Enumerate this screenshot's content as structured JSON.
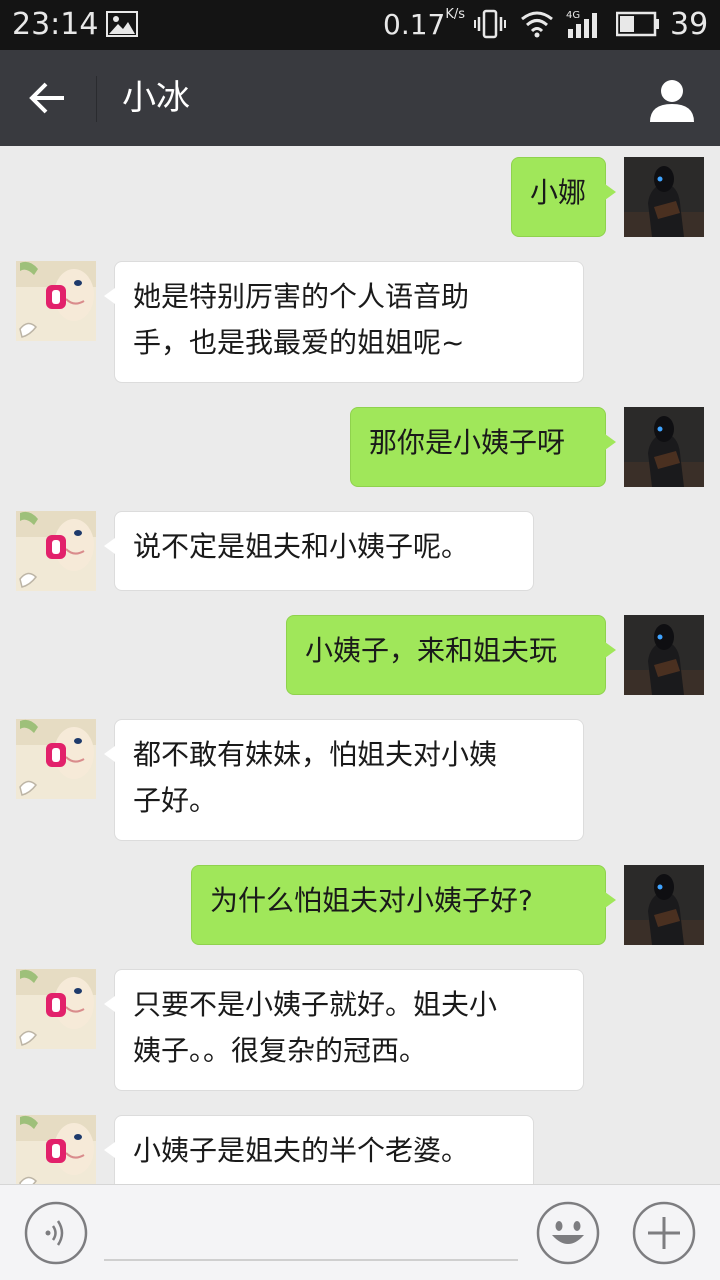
{
  "status_bar": {
    "time": "23:14",
    "net_speed": "0.17",
    "net_speed_unit": "K/s",
    "network_type": "4G",
    "battery_level": "39",
    "icons": [
      "image-icon",
      "vibrate-icon",
      "wifi-icon",
      "signal-icon",
      "battery-icon"
    ]
  },
  "header": {
    "title": "小冰",
    "back_icon": "arrow-left-icon",
    "profile_icon": "person-icon",
    "background": "#393a3f"
  },
  "messages": [
    {
      "side": "right",
      "text": "小娜"
    },
    {
      "side": "left",
      "text": "她是特别厉害的个人语音助\n手，也是我最爱的姐姐呢~"
    },
    {
      "side": "right",
      "text": "那你是小姨子呀"
    },
    {
      "side": "left",
      "text": "说不定是姐夫和小姨子呢。"
    },
    {
      "side": "right",
      "text": "小姨子，来和姐夫玩"
    },
    {
      "side": "left",
      "text": "都不敢有妹妹，怕姐夫对小姨\n子好。"
    },
    {
      "side": "right",
      "text": "为什么怕姐夫对小姨子好?"
    },
    {
      "side": "left",
      "text": "只要不是小姨子就好。姐夫小\n姨子。。很复杂的冠西。"
    },
    {
      "side": "left",
      "text": "小姨子是姐夫的半个老婆。"
    }
  ],
  "input_bar": {
    "voice_icon": "voice-icon",
    "emoji_icon": "smiley-icon",
    "more_icon": "plus-icon",
    "text_value": ""
  },
  "colors": {
    "sent_bubble": "#a0e75a",
    "received_bubble": "#ffffff",
    "chat_background": "#ebebeb"
  }
}
